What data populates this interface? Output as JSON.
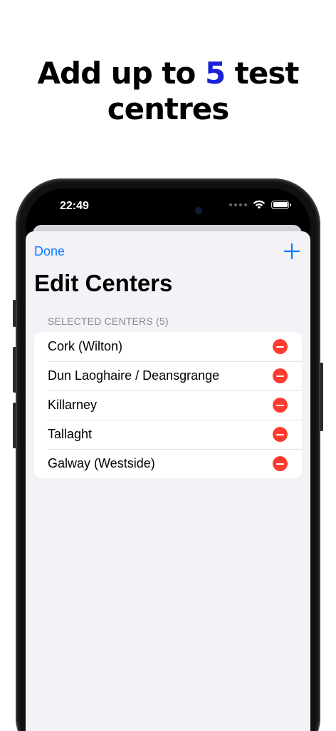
{
  "headline": {
    "prefix": "Add up to ",
    "accent": "5",
    "suffix": " test",
    "line2": "centres",
    "accent_color": "#1a22d6"
  },
  "status_bar": {
    "time": "22:49",
    "icons": [
      "signal-dots-icon",
      "wifi-icon",
      "battery-icon"
    ]
  },
  "nav": {
    "done_label": "Done",
    "add_icon": "plus-icon",
    "tint_color": "#0a7aff"
  },
  "page": {
    "title": "Edit Centers",
    "section_header": "SELECTED CENTERS (5)"
  },
  "centers": [
    {
      "label": "Cork (Wilton)"
    },
    {
      "label": "Dun Laoghaire / Deansgrange"
    },
    {
      "label": "Killarney"
    },
    {
      "label": "Tallaght"
    },
    {
      "label": "Galway (Westside)"
    }
  ],
  "colors": {
    "remove": "#ff3b30",
    "sheet_background": "#f2f2f7"
  }
}
